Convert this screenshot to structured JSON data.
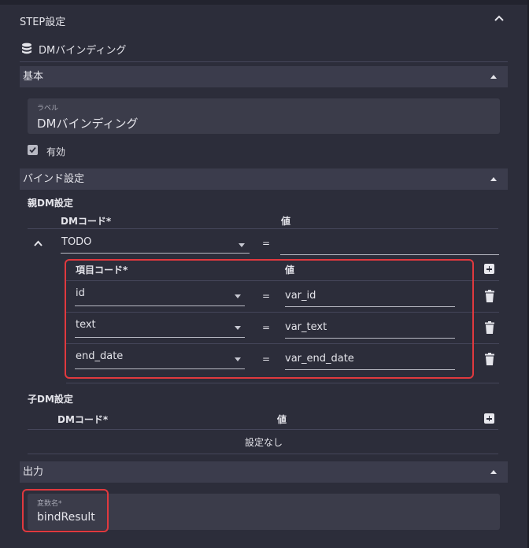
{
  "step_header": {
    "title": "STEP設定"
  },
  "node": {
    "icon": "database-icon",
    "title": "DMバインディング"
  },
  "basic": {
    "title": "基本",
    "label_field": {
      "label": "ラベル",
      "value": "DMバインディング"
    },
    "enabled": {
      "label": "有効",
      "checked": true
    }
  },
  "bind": {
    "title": "バインド設定",
    "parent": {
      "title": "親DM設定",
      "col_code": "DMコード*",
      "col_value": "値",
      "code": "TODO",
      "equals": "=",
      "value": "",
      "items_header": {
        "code": "項目コード*",
        "value": "値"
      },
      "items": [
        {
          "code": "id",
          "equals": "=",
          "value": "var_id"
        },
        {
          "code": "text",
          "equals": "=",
          "value": "var_text"
        },
        {
          "code": "end_date",
          "equals": "=",
          "value": "var_end_date"
        }
      ]
    },
    "child": {
      "title": "子DM設定",
      "col_code": "DMコード*",
      "col_value": "値",
      "empty": "設定なし"
    }
  },
  "output": {
    "title": "出力",
    "var_field": {
      "label": "変数名*",
      "value": "bindResult"
    }
  },
  "colors": {
    "background": "#2c2d3a",
    "section": "#3b3c4c",
    "highlight": "#e0393e"
  }
}
